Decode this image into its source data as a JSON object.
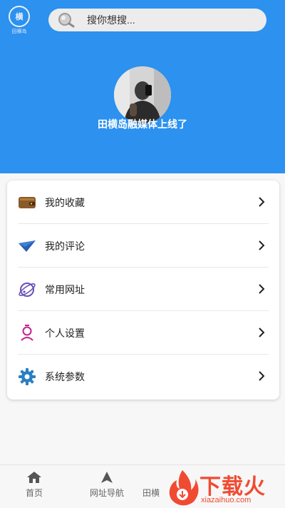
{
  "header": {
    "logo_text": "田横岛",
    "logo_glyph": "横",
    "search_placeholder": "搜你想搜...",
    "username": "田横岛融媒体上线了",
    "bg_color": "#2c91ef"
  },
  "menu": {
    "items": [
      {
        "label": "我的收藏",
        "icon": "wallet-icon"
      },
      {
        "label": "我的评论",
        "icon": "paper-plane-icon"
      },
      {
        "label": "常用网址",
        "icon": "planet-icon"
      },
      {
        "label": "个人设置",
        "icon": "user-settings-icon"
      },
      {
        "label": "系统参数",
        "icon": "gear-icon"
      }
    ]
  },
  "tabbar": {
    "items": [
      {
        "label": "首页",
        "icon": "home-icon"
      },
      {
        "label": "网址导航",
        "icon": "navigation-arrow-icon"
      },
      {
        "label": "田横",
        "icon": "tab-icon"
      }
    ]
  },
  "watermark": {
    "text": "下载火",
    "sub": "xiazaihuo.com",
    "color": "#f04b32"
  }
}
